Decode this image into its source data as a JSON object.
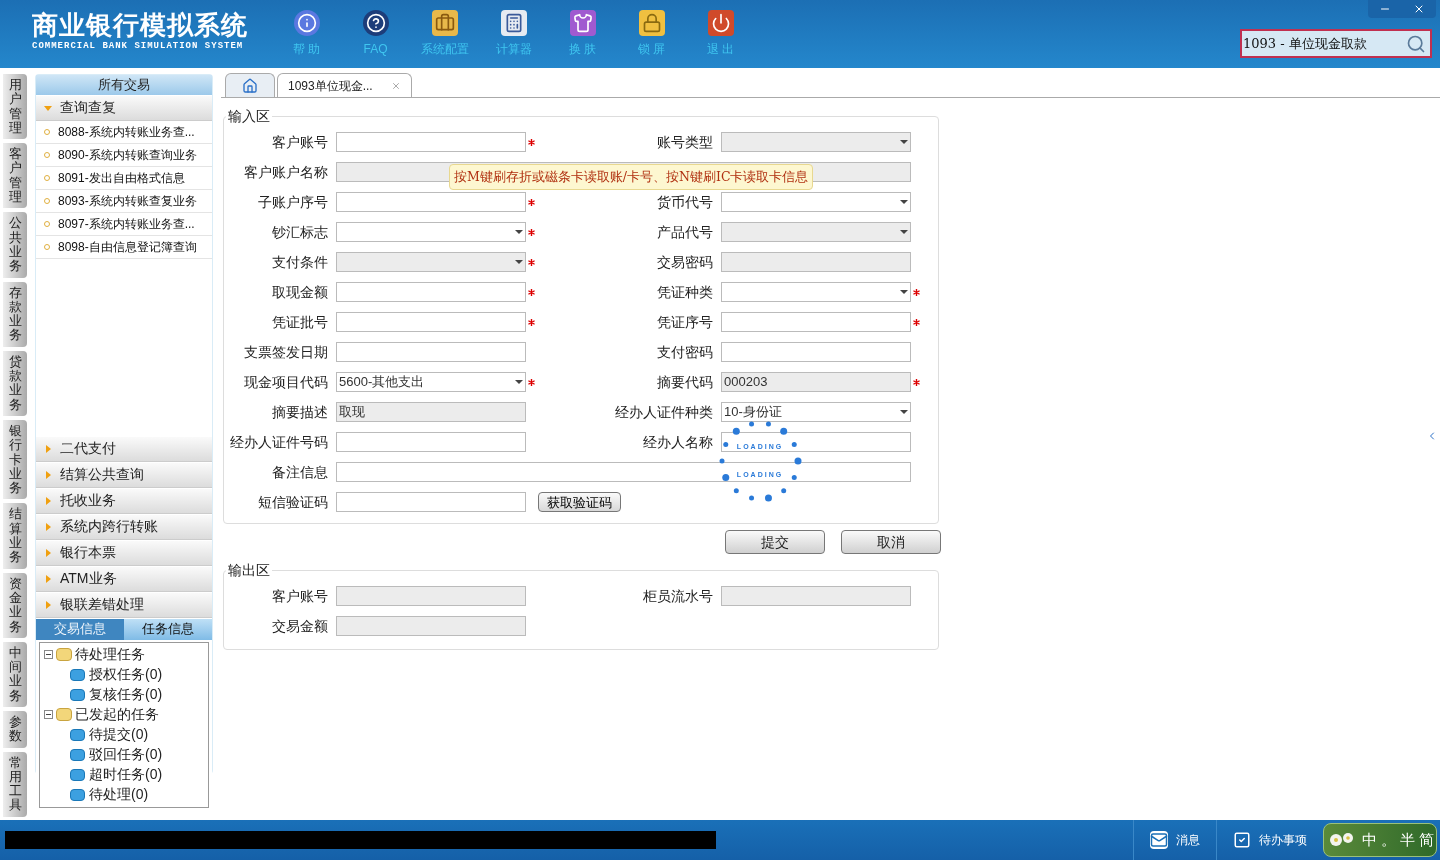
{
  "header": {
    "title": "商业银行模拟系统",
    "subtitle": "COMMERCIAL BANK SIMULATION SYSTEM",
    "tools": [
      {
        "kind": "info",
        "label": "帮 助"
      },
      {
        "kind": "faq",
        "label": "FAQ"
      },
      {
        "kind": "config",
        "label": "系统配置"
      },
      {
        "kind": "calc",
        "label": "计算器"
      },
      {
        "kind": "skin",
        "label": "换 肤"
      },
      {
        "kind": "lock",
        "label": "锁 屏"
      },
      {
        "kind": "exit",
        "label": "退 出"
      }
    ],
    "search": {
      "value": "1093 - 单位现金取款"
    }
  },
  "side_tabs": [
    "用户管理",
    "客户管理",
    "公共业务",
    "存款业务",
    "贷款业务",
    "银行卡业务",
    "结算业务",
    "资金业务",
    "中间业务",
    "参数",
    "常用工具"
  ],
  "sidebar": {
    "header": "所有交易",
    "groups": [
      {
        "label": "查询查复",
        "expanded": true,
        "items": [
          "8088-系统内转账业务查...",
          "8090-系统内转账查询业务",
          "8091-发出自由格式信息",
          "8093-系统内转账查复业务",
          "8097-系统内转账业务查...",
          "8098-自由信息登记簿查询"
        ]
      },
      {
        "label": "二代支付",
        "expanded": false
      },
      {
        "label": "结算公共查询",
        "expanded": false
      },
      {
        "label": "托收业务",
        "expanded": false
      },
      {
        "label": "系统内跨行转账",
        "expanded": false
      },
      {
        "label": "银行本票",
        "expanded": false
      },
      {
        "label": "ATM业务",
        "expanded": false
      },
      {
        "label": "银联差错处理",
        "expanded": false
      }
    ],
    "info_tabs": [
      {
        "label": "交易信息",
        "selected": false
      },
      {
        "label": "任务信息",
        "selected": true
      }
    ],
    "tree": [
      {
        "label": "待处理任务",
        "expanded": true,
        "children": [
          {
            "label": "授权任务(0)"
          },
          {
            "label": "复核任务(0)"
          }
        ]
      },
      {
        "label": "已发起的任务",
        "expanded": true,
        "children": [
          {
            "label": "待提交(0)"
          },
          {
            "label": "驳回任务(0)"
          },
          {
            "label": "超时任务(0)"
          },
          {
            "label": "待处理(0)"
          }
        ]
      }
    ]
  },
  "tabs": [
    {
      "kind": "home",
      "selected": false
    },
    {
      "kind": "page",
      "label": "1093单位现金...",
      "selected": true
    }
  ],
  "input_section": {
    "title": "输入区",
    "tooltip": "按M键刷存折或磁条卡读取账/卡号、按N键刷IC卡读取卡信息",
    "rows": [
      [
        {
          "label": "客户账号",
          "kind": "text",
          "required": true
        },
        {
          "label": "账号类型",
          "kind": "readonly-select",
          "required": false
        }
      ],
      [
        {
          "label": "客户账户名称",
          "kind": "readonly",
          "required": false,
          "wide": true
        }
      ],
      [
        {
          "label": "子账户序号",
          "kind": "text",
          "required": true
        },
        {
          "label": "货币代号",
          "kind": "select",
          "required": false
        }
      ],
      [
        {
          "label": "钞汇标志",
          "kind": "select",
          "required": true
        },
        {
          "label": "产品代号",
          "kind": "readonly-select",
          "required": false
        }
      ],
      [
        {
          "label": "支付条件",
          "kind": "readonly-select",
          "required": true
        },
        {
          "label": "交易密码",
          "kind": "readonly",
          "required": false
        }
      ],
      [
        {
          "label": "取现金额",
          "kind": "text",
          "required": true
        },
        {
          "label": "凭证种类",
          "kind": "select",
          "required": true
        }
      ],
      [
        {
          "label": "凭证批号",
          "kind": "text",
          "required": true
        },
        {
          "label": "凭证序号",
          "kind": "text",
          "required": true
        }
      ],
      [
        {
          "label": "支票签发日期",
          "kind": "text",
          "required": false
        },
        {
          "label": "支付密码",
          "kind": "text",
          "required": false
        }
      ],
      [
        {
          "label": "现金项目代码",
          "kind": "select",
          "value": "5600-其他支出",
          "required": true
        },
        {
          "label": "摘要代码",
          "kind": "readonly",
          "value": "000203",
          "required": true
        }
      ],
      [
        {
          "label": "摘要描述",
          "kind": "readonly",
          "value": "取现",
          "required": false
        },
        {
          "label": "经办人证件种类",
          "kind": "select",
          "value": "10-身份证",
          "required": false
        }
      ],
      [
        {
          "label": "经办人证件号码",
          "kind": "text",
          "required": false
        },
        {
          "label": "经办人名称",
          "kind": "text",
          "required": false
        }
      ],
      [
        {
          "label": "备注信息",
          "kind": "text",
          "required": false,
          "wide": true
        }
      ],
      [
        {
          "label": "短信验证码",
          "kind": "text",
          "required": false,
          "button": "获取验证码"
        }
      ]
    ]
  },
  "loading": [
    "LOADING",
    "LOADING"
  ],
  "actions": [
    "提交",
    "取消"
  ],
  "output_section": {
    "title": "输出区",
    "rows": [
      [
        {
          "label": "客户账号",
          "kind": "readonly",
          "required": false
        },
        {
          "label": "柜员流水号",
          "kind": "readonly",
          "required": false
        }
      ],
      [
        {
          "label": "交易金额",
          "kind": "readonly",
          "required": false
        }
      ]
    ]
  },
  "status_bar": {
    "items": [
      {
        "kind": "mail",
        "label": "消息"
      },
      {
        "kind": "check",
        "label": "待办事项"
      }
    ],
    "ime": [
      "中",
      "。",
      "半",
      "简"
    ]
  }
}
